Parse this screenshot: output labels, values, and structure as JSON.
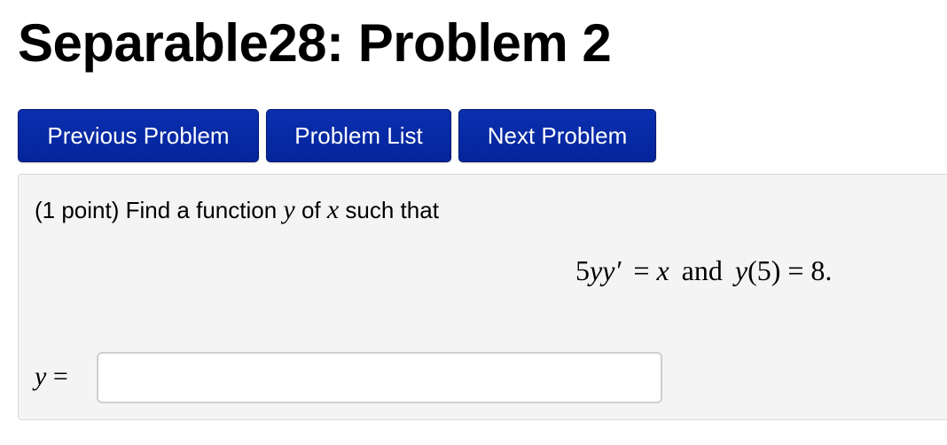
{
  "page": {
    "title": "Separable28: Problem 2"
  },
  "nav": {
    "previous_label": "Previous Problem",
    "list_label": "Problem List",
    "next_label": "Next Problem"
  },
  "problem": {
    "intro": "(1 point) Find a function ",
    "var_y": "y",
    "of_text": " of ",
    "var_x": "x",
    "suffix": " such that",
    "equation": {
      "lhs_coeff": "5",
      "lhs_var": "yy′",
      "equals_x": "= ",
      "x": "x",
      "and": "and",
      "cond_y": "y",
      "cond_arg": "(5) = 8."
    },
    "answer": {
      "var": "y",
      "equals": " =",
      "value": "",
      "placeholder": ""
    }
  },
  "colors": {
    "button_bg": "#0a2fb0",
    "button_text": "#ffffff",
    "panel_bg": "#f4f4f4"
  }
}
